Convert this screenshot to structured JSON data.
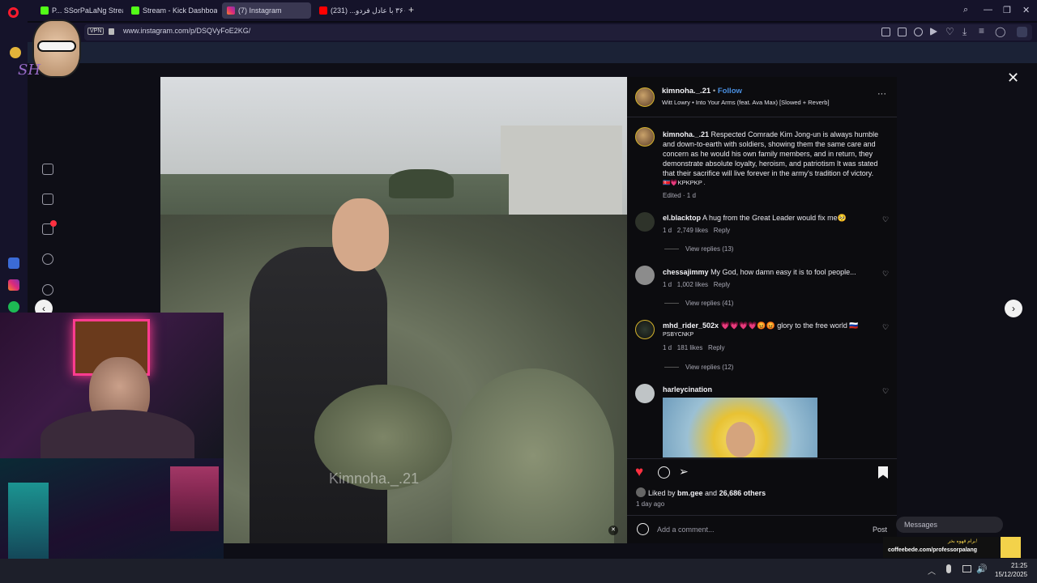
{
  "browser": {
    "tabs": [
      {
        "label": "P... SSorPaLaNg Stream",
        "color": "#53fc18"
      },
      {
        "label": "Stream - Kick Dashboard",
        "color": "#53fc18"
      },
      {
        "label": "(7) Instagram",
        "color": "#e1306c"
      },
      {
        "label": "لایو ۳۶۰ با عادل فردو... (231)",
        "color": "#ff0000"
      }
    ],
    "new_tab": "+",
    "vpn": "VPN",
    "url": "www.instagram.com/p/DSQVyFoE2KG/"
  },
  "post": {
    "author": "kimnoha._.21",
    "follow": "Follow",
    "audio": "Witt Lowry • Into Your Arms (feat. Ava Max) [Slowed + Reverb]",
    "more": "···",
    "caption": "Respected Comrade Kim Jong-un is always humble and down-to-earth with soldiers, showing them the same care and concern as he would his own family members, and in return, they demonstrate absolute loyalty, heroism, and patriotism It was stated that their sacrifice will live forever in the army's tradition of victory.",
    "caption_tail": "🇰🇵💗KPKPKP .",
    "edited": "Edited · 1 d",
    "watermark": "Kimnoha._.21",
    "comments": [
      {
        "user": "el.blacktop",
        "text": "A hug from the Great Leader would fix me🥺",
        "time": "1 d",
        "likes": "2,749 likes",
        "reply": "Reply",
        "view_replies": "View replies (13)"
      },
      {
        "user": "chessajimmy",
        "text": "My God, how damn easy it is to fool people...",
        "time": "1 d",
        "likes": "1,002 likes",
        "reply": "Reply",
        "view_replies": "View replies (41)"
      },
      {
        "user": "mhd_rider_502x",
        "text": "💗💗💗💗😡😡 glory to the free world 🇷🇺",
        "text2": "PSBYCNKP",
        "time": "1 d",
        "likes": "181 likes",
        "reply": "Reply",
        "view_replies": "View replies (12)"
      },
      {
        "user": "harleycination",
        "text": ""
      }
    ],
    "liked_by_prefix": "Liked by ",
    "liked_by_user": "bm.gee",
    "liked_by_and": " and ",
    "liked_by_others": "26,686 others",
    "posted_ago": "1 day ago",
    "add_comment_placeholder": "Add a comment...",
    "post_button": "Post",
    "messages": "Messages",
    "colors": {
      "heart": "#ff3040",
      "follow": "#4a90e2"
    }
  },
  "overlay": {
    "donation_title": "برام قهوه بخر!",
    "donation_url": "coffeebede.com/professorpalang",
    "sticker_text": "SH"
  },
  "taskbar": {
    "time": "21:25",
    "date": "15/12/2025"
  }
}
